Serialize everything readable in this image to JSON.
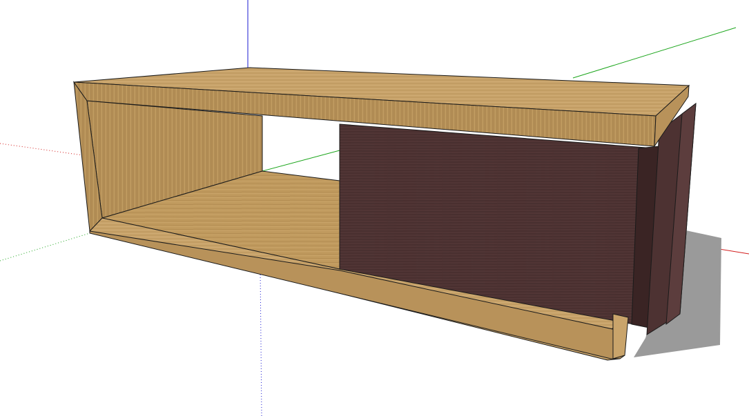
{
  "app": {
    "view": "perspective",
    "background_color": "#ffffff"
  },
  "axes": {
    "red_axis_color": "#d21a1a",
    "green_axis_color": "#1aa51a",
    "blue_axis_color": "#1a1ad2",
    "hidden_line_style": "dotted"
  },
  "model": {
    "object": "coffee-table",
    "materials": {
      "light_wood_top": "#caa46b",
      "light_wood_edge": "#b48a4d",
      "light_wood_inner": "#a98550",
      "dark_wood_panel": "#4a3030",
      "dark_wood_edge": "#3a2424",
      "shadow": "#9a9a9a",
      "outline": "#1a1a1a"
    }
  }
}
